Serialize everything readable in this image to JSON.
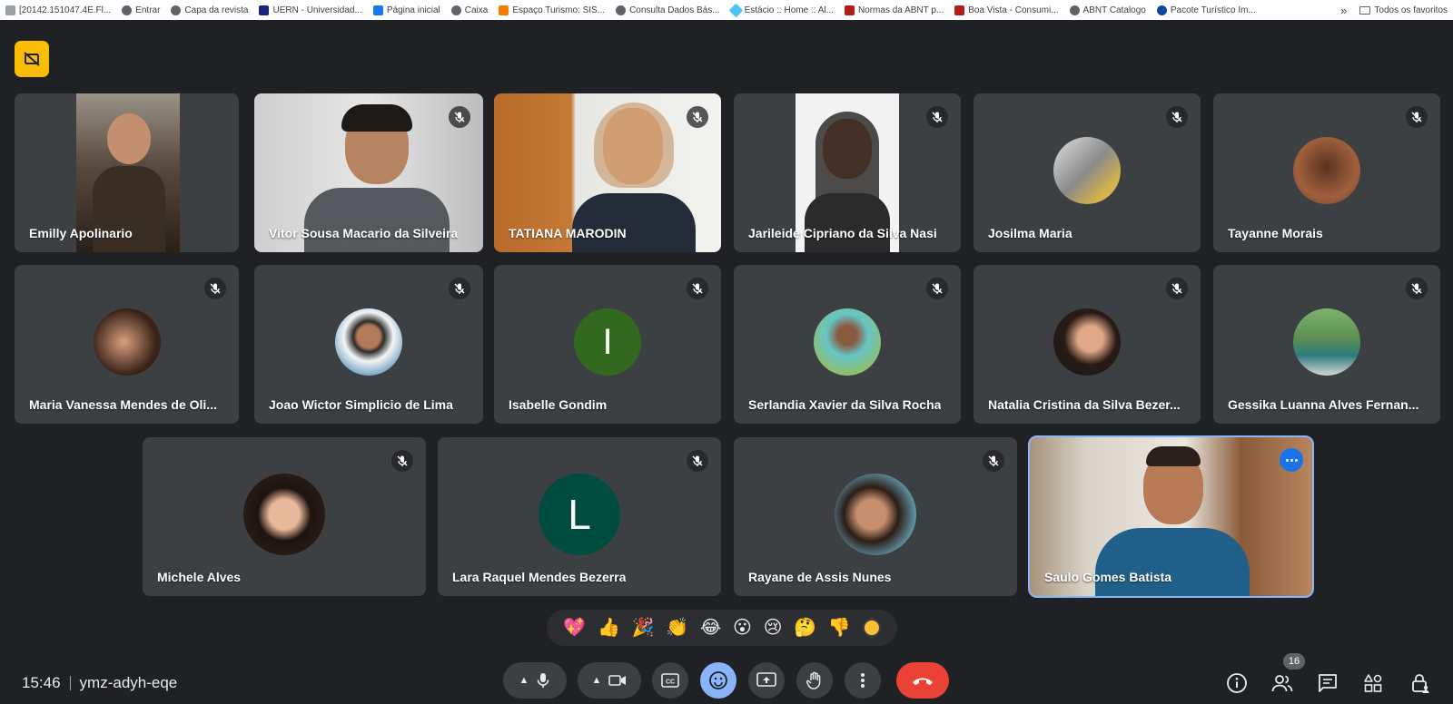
{
  "bookmarks": [
    {
      "label": "[20142.151047.4E.Fl..."
    },
    {
      "label": "Entrar"
    },
    {
      "label": "Capa da revista"
    },
    {
      "label": "UERN - Universidad..."
    },
    {
      "label": "Página inicial"
    },
    {
      "label": "Caixa"
    },
    {
      "label": "Espaço Turismo: SIS..."
    },
    {
      "label": "Consulta Dados Bás..."
    },
    {
      "label": "Estácio :: Home :: Al..."
    },
    {
      "label": "Normas da ABNT p..."
    },
    {
      "label": "Boa Vista - Consumi..."
    },
    {
      "label": "ABNT Catalogo"
    },
    {
      "label": "Pacote Turístico Im..."
    }
  ],
  "bookmarks_more": "»",
  "bookmarks_all": "Todos os favoritos",
  "participants": [
    {
      "name": "Emilly Apolinario"
    },
    {
      "name": "Vitor Sousa Macario da Silveira"
    },
    {
      "name": "TATIANA MARODIN"
    },
    {
      "name": "Jarileide Cipriano da Silva Nasi"
    },
    {
      "name": "Josilma Maria"
    },
    {
      "name": "Tayanne Morais"
    },
    {
      "name": "Maria Vanessa Mendes de Oli..."
    },
    {
      "name": "Joao Wictor Simplicio de Lima"
    },
    {
      "name": "Isabelle Gondim",
      "initial": "I"
    },
    {
      "name": "Serlandia Xavier da Silva Rocha"
    },
    {
      "name": "Natalia Cristina da Silva Bezer..."
    },
    {
      "name": "Gessika Luanna Alves Fernan..."
    },
    {
      "name": "Michele Alves"
    },
    {
      "name": "Lara Raquel Mendes Bezerra",
      "initial": "L"
    },
    {
      "name": "Rayane de Assis Nunes"
    },
    {
      "name": "Saulo Gomes Batista"
    }
  ],
  "reactions": [
    "💖",
    "👍",
    "🎉",
    "👏",
    "😂",
    "😮",
    "😢",
    "🤔",
    "👎"
  ],
  "meeting": {
    "time": "15:46",
    "code": "ymz-adyh-eqe"
  },
  "people_count": "16",
  "colors": {
    "background": "#202124",
    "tile": "#3c4043",
    "accent": "#8ab4f8",
    "end_call": "#ea4335",
    "host_badge": "#fbbc04"
  }
}
